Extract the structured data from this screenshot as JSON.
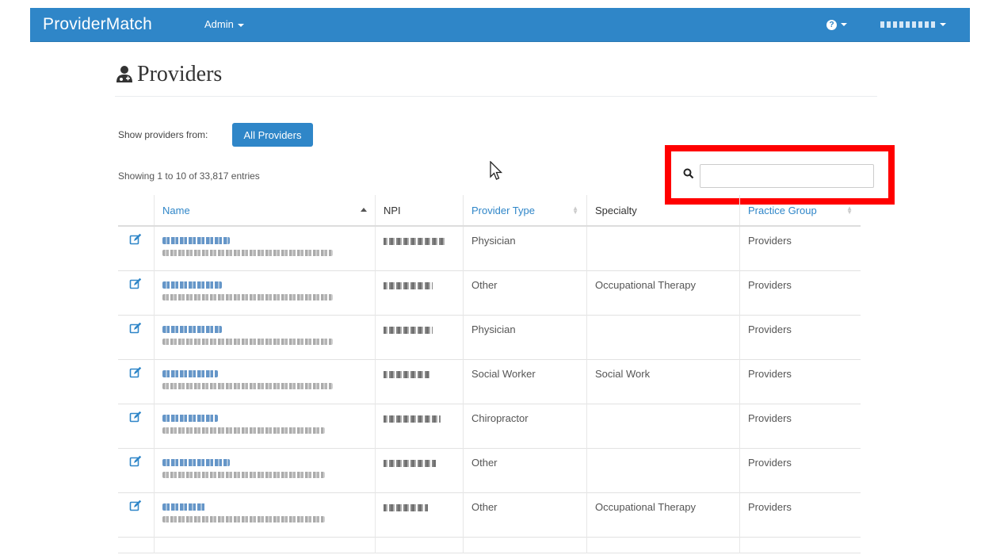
{
  "navbar": {
    "brand": "ProviderMatch",
    "admin_label": "Admin",
    "help_icon": "question-circle-icon",
    "user_icon": "user-icon"
  },
  "page": {
    "title": "Providers",
    "title_icon": "user-md-icon"
  },
  "filter": {
    "label": "Show providers from:",
    "button": "All Providers"
  },
  "table_info": "Showing 1 to 10 of 33,817 entries",
  "search": {
    "icon": "search-icon",
    "value": "",
    "placeholder": ""
  },
  "table": {
    "columns": [
      "",
      "Name",
      "NPI",
      "Provider Type",
      "Specialty",
      "Practice Group"
    ],
    "rows": [
      {
        "provider_type": "Physician",
        "specialty": "",
        "practice_group": "Providers"
      },
      {
        "provider_type": "Other",
        "specialty": "Occupational Therapy",
        "practice_group": "Providers"
      },
      {
        "provider_type": "Physician",
        "specialty": "",
        "practice_group": "Providers"
      },
      {
        "provider_type": "Social Worker",
        "specialty": "Social Work",
        "practice_group": "Providers"
      },
      {
        "provider_type": "Chiropractor",
        "specialty": "",
        "practice_group": "Providers"
      },
      {
        "provider_type": "Other",
        "specialty": "",
        "practice_group": "Providers"
      },
      {
        "provider_type": "Other",
        "specialty": "Occupational Therapy",
        "practice_group": "Providers"
      }
    ]
  },
  "colors": {
    "primary": "#2f86c8",
    "highlight": "#ff0000"
  }
}
